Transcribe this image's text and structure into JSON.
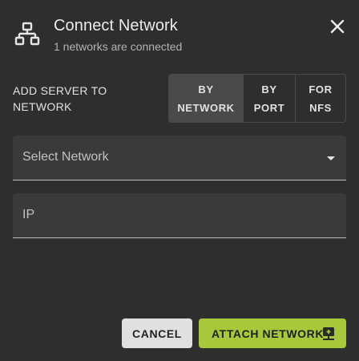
{
  "dialog": {
    "title": "Connect Network",
    "subtitle": "1 networks are connected",
    "header_icon": "network-icon",
    "close_icon": "close-icon"
  },
  "add_server": {
    "label": "ADD SERVER TO NETWORK",
    "options": [
      {
        "label": "BY NETWORK",
        "active": true
      },
      {
        "label": "BY PORT",
        "active": false
      },
      {
        "label": "FOR NFS",
        "active": false
      }
    ]
  },
  "fields": {
    "network": {
      "label": "Select Network",
      "value": ""
    },
    "ip": {
      "label": "IP",
      "value": ""
    }
  },
  "actions": {
    "cancel_label": "CANCEL",
    "attach_label": "ATTACH NETWORK",
    "attach_icon": "lan-connect-icon"
  },
  "colors": {
    "background": "#2e2e2e",
    "field": "#3a3a3a",
    "active_toggle": "#4a4a4a",
    "accent": "#a6c83a",
    "cancel": "#e0e0e0"
  }
}
